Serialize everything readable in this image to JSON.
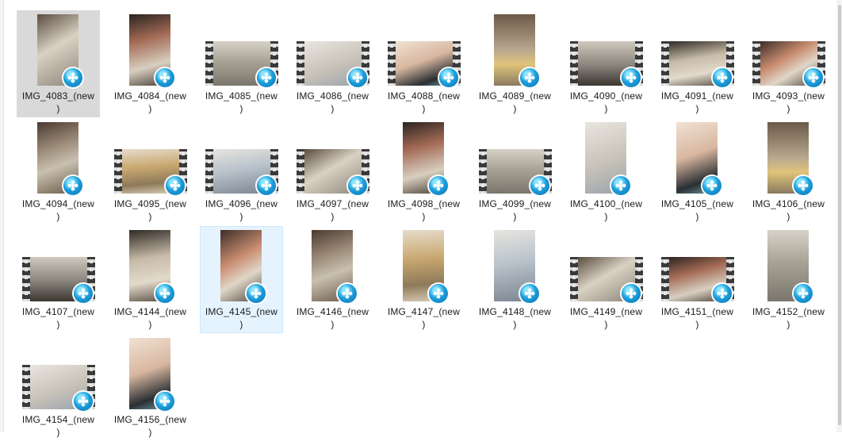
{
  "window": {
    "view": "Large icons"
  },
  "colors": {
    "selected_background": "#d9d9d9",
    "hover_background": "#e5f3ff",
    "media_badge": "#1da0dd"
  },
  "files": [
    {
      "line1": "IMG_4083_(new",
      "line2": ")",
      "kind": "portrait",
      "badge": "media-player-icon",
      "state": "selected"
    },
    {
      "line1": "IMG_4084_(new",
      "line2": ")",
      "kind": "portrait",
      "badge": "media-player-icon",
      "state": "normal"
    },
    {
      "line1": "IMG_4085_(new",
      "line2": ")",
      "kind": "landscape",
      "badge": "media-player-icon",
      "state": "normal"
    },
    {
      "line1": "IMG_4086_(new",
      "line2": ")",
      "kind": "landscape",
      "badge": "media-player-icon",
      "state": "normal"
    },
    {
      "line1": "IMG_4088_(new",
      "line2": ")",
      "kind": "landscape",
      "badge": "media-player-icon",
      "state": "normal"
    },
    {
      "line1": "IMG_4089_(new",
      "line2": ")",
      "kind": "portrait",
      "badge": "media-player-icon",
      "state": "normal"
    },
    {
      "line1": "IMG_4090_(new",
      "line2": ")",
      "kind": "landscape",
      "badge": "media-player-icon",
      "state": "normal"
    },
    {
      "line1": "IMG_4091_(new",
      "line2": ")",
      "kind": "landscape",
      "badge": "media-player-icon",
      "state": "normal"
    },
    {
      "line1": "IMG_4093_(new",
      "line2": ")",
      "kind": "landscape",
      "badge": "media-player-icon",
      "state": "normal"
    },
    {
      "line1": "IMG_4094_(new",
      "line2": ")",
      "kind": "portrait",
      "badge": "media-player-icon",
      "state": "normal"
    },
    {
      "line1": "IMG_4095_(new",
      "line2": ")",
      "kind": "landscape",
      "badge": "media-player-icon",
      "state": "normal"
    },
    {
      "line1": "IMG_4096_(new",
      "line2": ")",
      "kind": "landscape",
      "badge": "media-player-icon",
      "state": "normal"
    },
    {
      "line1": "IMG_4097_(new",
      "line2": ")",
      "kind": "landscape",
      "badge": "media-player-icon",
      "state": "normal"
    },
    {
      "line1": "IMG_4098_(new",
      "line2": ")",
      "kind": "portrait",
      "badge": "media-player-icon",
      "state": "normal"
    },
    {
      "line1": "IMG_4099_(new",
      "line2": ")",
      "kind": "landscape",
      "badge": "media-player-icon",
      "state": "normal"
    },
    {
      "line1": "IMG_4100_(new",
      "line2": ")",
      "kind": "portrait",
      "badge": "media-player-icon",
      "state": "normal"
    },
    {
      "line1": "IMG_4105_(new",
      "line2": ")",
      "kind": "portrait",
      "badge": "media-player-icon",
      "state": "normal"
    },
    {
      "line1": "IMG_4106_(new",
      "line2": ")",
      "kind": "portrait",
      "badge": "media-player-icon",
      "state": "normal"
    },
    {
      "line1": "IMG_4107_(new",
      "line2": ")",
      "kind": "landscape",
      "badge": "media-player-icon",
      "state": "normal"
    },
    {
      "line1": "IMG_4144_(new",
      "line2": ")",
      "kind": "portrait",
      "badge": "media-player-icon",
      "state": "normal"
    },
    {
      "line1": "IMG_4145_(new",
      "line2": ")",
      "kind": "portrait",
      "badge": "media-player-icon",
      "state": "hover"
    },
    {
      "line1": "IMG_4146_(new",
      "line2": ")",
      "kind": "portrait",
      "badge": "media-player-icon",
      "state": "normal"
    },
    {
      "line1": "IMG_4147_(new",
      "line2": ")",
      "kind": "portrait",
      "badge": "media-player-icon",
      "state": "normal"
    },
    {
      "line1": "IMG_4148_(new",
      "line2": ")",
      "kind": "portrait",
      "badge": "media-player-icon",
      "state": "normal"
    },
    {
      "line1": "IMG_4149_(new",
      "line2": ")",
      "kind": "landscape",
      "badge": "media-player-icon",
      "state": "normal"
    },
    {
      "line1": "IMG_4151_(new",
      "line2": ")",
      "kind": "landscape",
      "badge": "media-player-icon",
      "state": "normal"
    },
    {
      "line1": "IMG_4152_(new",
      "line2": ")",
      "kind": "portrait",
      "badge": "media-player-icon",
      "state": "normal"
    },
    {
      "line1": "IMG_4154_(new",
      "line2": ")",
      "kind": "landscape",
      "badge": "media-player-icon",
      "state": "normal"
    },
    {
      "line1": "IMG_4156_(new",
      "line2": ")",
      "kind": "portrait",
      "badge": "media-player-icon",
      "state": "normal"
    }
  ]
}
